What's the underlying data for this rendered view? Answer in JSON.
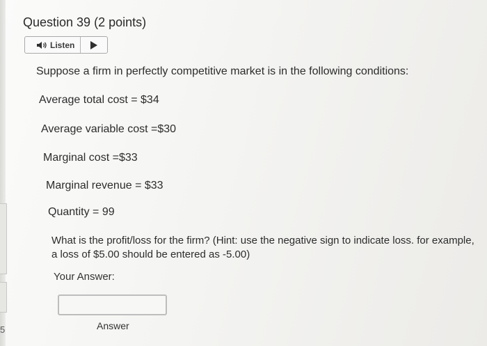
{
  "question": {
    "number_label": "Question 39",
    "points_label": "(2 points)"
  },
  "listen": {
    "label": "Listen",
    "speaker_icon": "speaker-icon",
    "play_icon": "play-icon"
  },
  "content": {
    "intro": "Suppose a firm in perfectly competitive market is in the following conditions:",
    "conditions": [
      "Average total cost = $34",
      "Average variable cost =$30",
      "Marginal cost =$33",
      "Marginal revenue = $33",
      "Quantity = 99"
    ],
    "question_text": "What is the profit/loss for the firm? (Hint: use the negative sign to indicate loss.  for example, a loss of $5.00 should be entered as -5.00)"
  },
  "answer": {
    "label": "Your Answer:",
    "value": "",
    "caption": "Answer"
  },
  "sidebar": {
    "edge_number": "5"
  }
}
